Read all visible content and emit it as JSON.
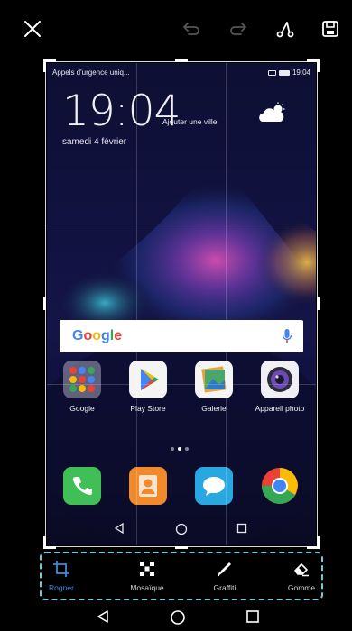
{
  "toolbar": {
    "close": "close-icon",
    "undo": "undo-icon",
    "redo": "redo-icon",
    "share": "share-icon",
    "save": "save-icon"
  },
  "screenshot": {
    "status_left": "Appels d'urgence uniq...",
    "status_time": "19:04",
    "clock": "19:04",
    "add_city": "Ajouter une ville",
    "date": "samedi 4 février",
    "search_brand": "Google",
    "apps": [
      {
        "label": "Google",
        "icon": "google-folder-icon"
      },
      {
        "label": "Play Store",
        "icon": "play-store-icon"
      },
      {
        "label": "Galerie",
        "icon": "gallery-icon"
      },
      {
        "label": "Appareil photo",
        "icon": "camera-icon"
      }
    ],
    "dock": [
      {
        "icon": "phone-icon",
        "color": "#3fbf55"
      },
      {
        "icon": "contacts-icon",
        "color": "#f08a2c"
      },
      {
        "icon": "messages-icon",
        "color": "#29a7e0"
      },
      {
        "icon": "chrome-icon",
        "color": "#ffffff"
      }
    ]
  },
  "tools": [
    {
      "label": "Rogner",
      "icon": "crop-icon",
      "active": true
    },
    {
      "label": "Mosaïque",
      "icon": "mosaic-icon",
      "active": false
    },
    {
      "label": "Graffiti",
      "icon": "pen-icon",
      "active": false
    },
    {
      "label": "Gomme",
      "icon": "eraser-icon",
      "active": false
    }
  ],
  "colors": {
    "accent": "#3e8ad8",
    "dashed_highlight": "#78c8d8",
    "background": "#000000"
  }
}
